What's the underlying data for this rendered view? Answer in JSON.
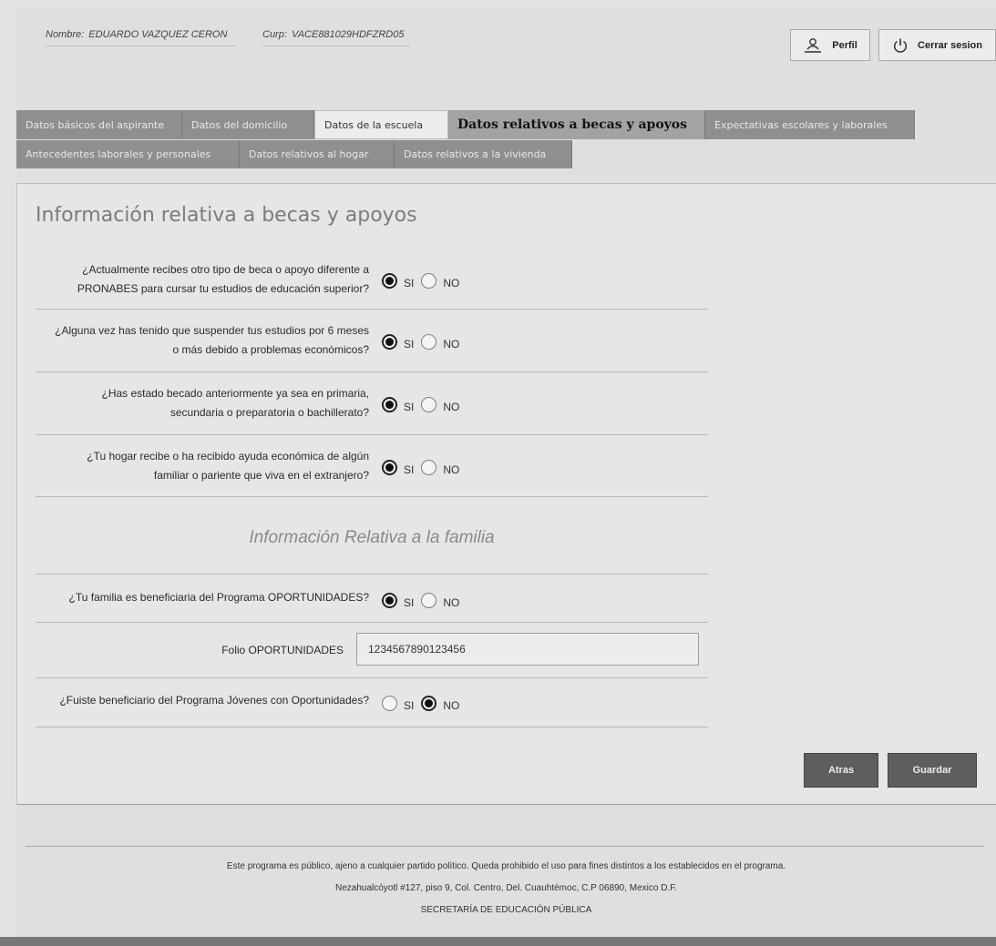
{
  "header": {
    "name_label": "Nombre:",
    "name_value": "EDUARDO VAZQUEZ CERON",
    "curp_label": "Curp:",
    "curp_value": "VACE881029HDFZRD05",
    "profile_button": "Perfil",
    "profile_icon": "user-id-icon",
    "logout_button": "Cerrar sesion",
    "logout_icon": "power-icon"
  },
  "tabs_row1": [
    {
      "label": "Datos básicos del aspirante"
    },
    {
      "label": "Datos del domicilio"
    },
    {
      "label": "Datos de la escuela"
    },
    {
      "label": "Datos relativos a becas y apoyos"
    },
    {
      "label": "Expectativas escolares y laborales"
    }
  ],
  "tabs_row2": [
    {
      "label": "Antecedentes laborales y personales"
    },
    {
      "label": "Datos relativos al hogar"
    },
    {
      "label": "Datos relativos a la vivienda"
    }
  ],
  "section": {
    "title": "Información relativa a becas y apoyos",
    "questions": [
      {
        "line1": "¿Actualmente recibes otro tipo de beca o apoyo diferente a",
        "line2": "PRONABES para cursar tu estudios de educación superior?",
        "selected": "SI"
      },
      {
        "line1": "¿Alguna vez has tenido que suspender tus estudios por 6 meses",
        "line2": "o más debido a problemas económicos?",
        "selected": "SI"
      },
      {
        "line1": "¿Has estado becado anteriormente ya sea en primaria,",
        "line2": "secundaria o preparatoria o bachillerato?",
        "selected": "SI"
      },
      {
        "line1": "¿Tu hogar recibe o ha recibido ayuda económica de algún",
        "line2": "familiar o pariente que viva en el extranjero?",
        "selected": "SI"
      }
    ],
    "radio_yes": "SI",
    "radio_no": "NO"
  },
  "family": {
    "title": "Información Relativa a la familia",
    "q_oportunidades": "¿Tu familia es beneficiaria del Programa OPORTUNIDADES?",
    "q_oportunidades_selected": "SI",
    "folio_label": "Folio OPORTUNIDADES",
    "folio_value": "1234567890123456",
    "q_jovenes": "¿Fuiste beneficiario del Programa Jóvenes con Oportunidades?",
    "q_jovenes_selected": "NO"
  },
  "actions": {
    "back": "Atras",
    "save": "Guardar"
  },
  "footer": {
    "line1": "Este programa es público, ajeno a cualquier partido político. Queda prohibido el uso para fines distintos a los establecidos en el programa.",
    "line2": "Nezahualcóyotl #127, piso 9, Col. Centro, Del. Cuauhtémoc, C.P 06890, Mexico D.F.",
    "line3": "SECRETARÍA DE EDUCACIÓN PÚBLICA"
  }
}
